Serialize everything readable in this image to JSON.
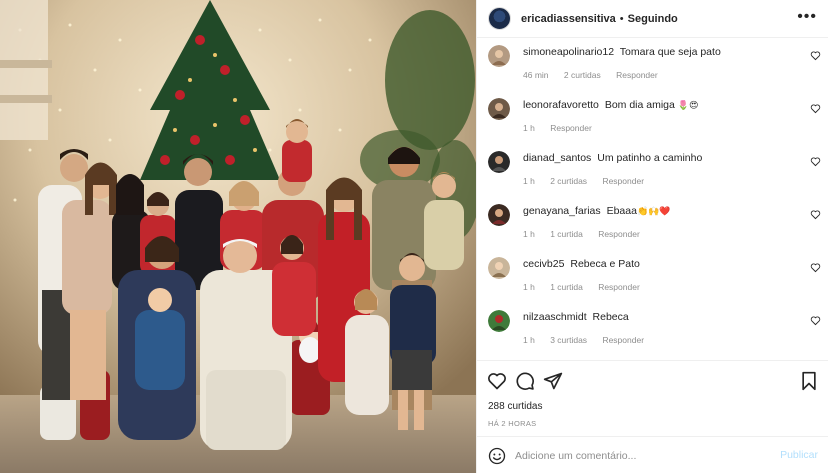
{
  "post": {
    "username": "ericadiassensitiva",
    "separator": "•",
    "follow_status": "Seguindo",
    "more_label": "•••",
    "avatar_icon": "profile-avatar"
  },
  "comments": [
    {
      "user": "simoneapolinario12",
      "text": "Tomara que seja pato",
      "emoji": "",
      "time": "46 min",
      "likes": "2 curtidas",
      "reply": "Responder"
    },
    {
      "user": "leonorafavoretto",
      "text": "Bom dia amiga",
      "emoji": "🌷😍",
      "time": "1 h",
      "likes": "",
      "reply": "Responder"
    },
    {
      "user": "dianad_santos",
      "text": "Um patinho a caminho",
      "emoji": "",
      "time": "1 h",
      "likes": "2 curtidas",
      "reply": "Responder"
    },
    {
      "user": "genayana_farias",
      "text": "Ebaaa",
      "emoji": "👏🙌❤️",
      "time": "1 h",
      "likes": "1 curtida",
      "reply": "Responder"
    },
    {
      "user": "cecivb25",
      "text": "Rebeca e Pato",
      "emoji": "",
      "time": "1 h",
      "likes": "1 curtida",
      "reply": "Responder"
    },
    {
      "user": "nilzaaschmidt",
      "text": "Rebeca",
      "emoji": "",
      "time": "1 h",
      "likes": "3 curtidas",
      "reply": "Responder"
    }
  ],
  "actions": {
    "likes_count": "288 curtidas",
    "time_ago": "HÁ 2 HORAS",
    "comment_placeholder": "Adicione um comentário...",
    "publish_label": "Publicar"
  },
  "colors": {
    "link_blue_disabled": "#b2dffc",
    "muted_text": "#8e8e8e",
    "primary_text": "#262626",
    "divider": "#efefef"
  }
}
